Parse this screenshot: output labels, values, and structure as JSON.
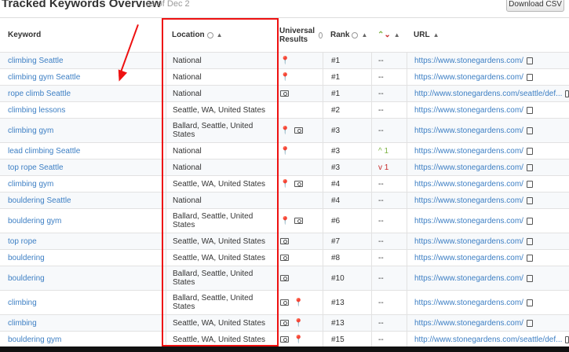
{
  "header": {
    "title": "Tracked Keywords Overview",
    "as_of": "as of Dec 2",
    "download_label": "Download CSV"
  },
  "columns": {
    "keyword": "Keyword",
    "location": "Location",
    "universal": "Universal Results",
    "rank": "Rank",
    "url": "URL",
    "sort_arrow": "▲"
  },
  "rows": [
    {
      "keyword": "climbing Seattle",
      "location": "National",
      "rank": "#1",
      "change": "--",
      "url": "https://www.stonegardens.com/",
      "icons": [
        "pin"
      ]
    },
    {
      "keyword": "climbing gym Seattle",
      "location": "National",
      "rank": "#1",
      "change": "--",
      "url": "https://www.stonegardens.com/",
      "icons": [
        "pin"
      ]
    },
    {
      "keyword": "rope climb Seattle",
      "location": "National",
      "rank": "#1",
      "change": "--",
      "url": "http://www.stonegardens.com/seattle/def...",
      "icons": [
        "cam"
      ]
    },
    {
      "keyword": "climbing lessons",
      "location": "Seattle, WA, United States",
      "rank": "#2",
      "change": "--",
      "url": "https://www.stonegardens.com/",
      "icons": []
    },
    {
      "keyword": "climbing gym",
      "location": "Ballard, Seattle, United States",
      "rank": "#3",
      "change": "--",
      "url": "https://www.stonegardens.com/",
      "icons": [
        "pin",
        "cam"
      ]
    },
    {
      "keyword": "lead climbing Seattle",
      "location": "National",
      "rank": "#3",
      "change": "^ 1",
      "url": "https://www.stonegardens.com/",
      "icons": [
        "pin"
      ]
    },
    {
      "keyword": "top rope Seattle",
      "location": "National",
      "rank": "#3",
      "change": "v 1",
      "url": "https://www.stonegardens.com/",
      "icons": []
    },
    {
      "keyword": "climbing gym",
      "location": "Seattle, WA, United States",
      "rank": "#4",
      "change": "--",
      "url": "https://www.stonegardens.com/",
      "icons": [
        "pin",
        "cam"
      ]
    },
    {
      "keyword": "bouldering Seattle",
      "location": "National",
      "rank": "#4",
      "change": "--",
      "url": "https://www.stonegardens.com/",
      "icons": []
    },
    {
      "keyword": "bouldering gym",
      "location": "Ballard, Seattle, United States",
      "rank": "#6",
      "change": "--",
      "url": "https://www.stonegardens.com/",
      "icons": [
        "pin",
        "cam"
      ]
    },
    {
      "keyword": "top rope",
      "location": "Seattle, WA, United States",
      "rank": "#7",
      "change": "--",
      "url": "https://www.stonegardens.com/",
      "icons": [
        "cam"
      ]
    },
    {
      "keyword": "bouldering",
      "location": "Seattle, WA, United States",
      "rank": "#8",
      "change": "--",
      "url": "https://www.stonegardens.com/",
      "icons": [
        "cam"
      ]
    },
    {
      "keyword": "bouldering",
      "location": "Ballard, Seattle, United States",
      "rank": "#10",
      "change": "--",
      "url": "https://www.stonegardens.com/",
      "icons": [
        "cam"
      ]
    },
    {
      "keyword": "climbing",
      "location": "Ballard, Seattle, United States",
      "rank": "#13",
      "change": "--",
      "url": "https://www.stonegardens.com/",
      "icons": [
        "cam",
        "pin"
      ]
    },
    {
      "keyword": "climbing",
      "location": "Seattle, WA, United States",
      "rank": "#13",
      "change": "--",
      "url": "https://www.stonegardens.com/",
      "icons": [
        "cam",
        "pin"
      ]
    },
    {
      "keyword": "bouldering gym",
      "location": "Seattle, WA, United States",
      "rank": "#15",
      "change": "--",
      "url": "http://www.stonegardens.com/seattle/def...",
      "icons": [
        "cam",
        "pin"
      ]
    }
  ],
  "colors": {
    "link": "#3d7fc4",
    "highlight": "#e11111",
    "up": "#7cb342",
    "down": "#c62828"
  }
}
